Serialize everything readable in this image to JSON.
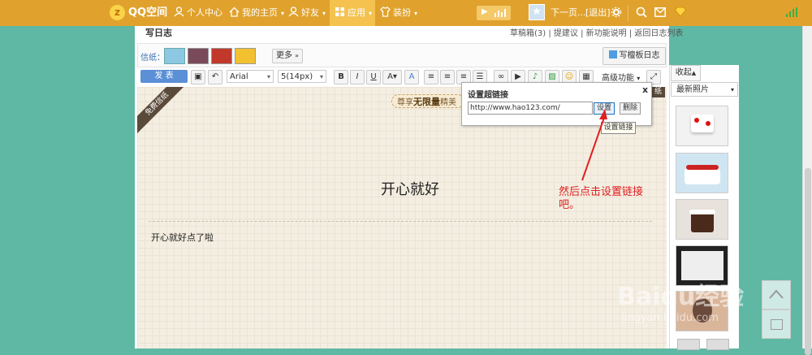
{
  "topbar": {
    "brand": "QQ空间",
    "nav": [
      "个人中心",
      "我的主页",
      "好友",
      "应用",
      "装扮"
    ],
    "next": "下一页...",
    "logout": "[退出]"
  },
  "editor": {
    "heading": "写日志",
    "links": [
      "草稿箱(3)",
      "提建议",
      "新功能说明",
      "返回日志列表"
    ],
    "paper_label": "信纸：",
    "more": "更多",
    "board_btn": "写檀板日志",
    "publish": "发 表",
    "font": "Arial",
    "size": "5(14px)",
    "advanced": "高级功能",
    "ribbon": "免费信纸",
    "banner_pre": "尊享",
    "banner_strong": "无限量",
    "banner_post": "精美",
    "right_tag": "纸",
    "title": "开心就好",
    "body": "开心就好点了啦"
  },
  "dialog": {
    "title": "设置超链接",
    "close": "x",
    "url": "http://www.hao123.com/",
    "set": "设置",
    "delete": "删除",
    "tooltip": "设置链接"
  },
  "annotation": {
    "text": "然后点击设置链接吧。",
    "color": "#e02020"
  },
  "side": {
    "collect": "收起",
    "latest": "最新照片"
  },
  "watermark": {
    "logo": "Baidu经验",
    "url": "jingyan.baidu.com"
  },
  "colors": {
    "topbar": "#e0a22d",
    "background": "#5fb8a3",
    "publish": "#5b8fd6"
  }
}
